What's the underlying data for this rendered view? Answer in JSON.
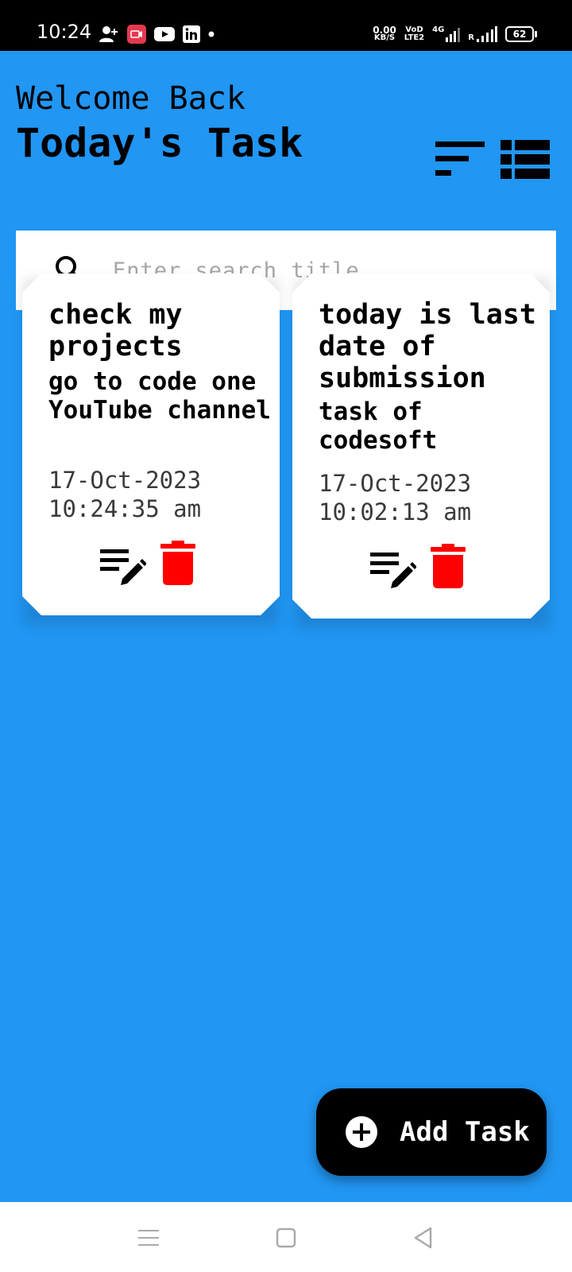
{
  "status_bar": {
    "time": "10:24",
    "net_speed_top": "0.00",
    "net_speed_bottom": "KB/S",
    "volte_top": "VoD",
    "volte_bottom": "LTE2",
    "network_type": "4G",
    "roaming": "R",
    "battery": "62",
    "icons_left": [
      "add-contact-icon",
      "screen-record-icon",
      "youtube-icon",
      "linkedin-icon",
      "notification-dot-icon"
    ]
  },
  "header": {
    "welcome": "Welcome Back",
    "title": "Today's Task",
    "sort_icon": "sort-icon",
    "view_icon": "list-view-icon"
  },
  "search": {
    "placeholder": "Enter search title",
    "icon": "search-icon"
  },
  "tasks": [
    {
      "title": "check my projects",
      "description": "go to code one YouTube channel",
      "date": "17-Oct-2023",
      "time": "10:24:35 am"
    },
    {
      "title": "today is last date of submission",
      "description": "task of codesoft",
      "date": "17-Oct-2023",
      "time": "10:02:13 am"
    }
  ],
  "fab": {
    "label": "Add Task",
    "icon": "plus-circle-icon"
  },
  "colors": {
    "background": "#2196F3",
    "card": "#FFFFFF",
    "delete": "#FF0000",
    "fab": "#000000"
  }
}
